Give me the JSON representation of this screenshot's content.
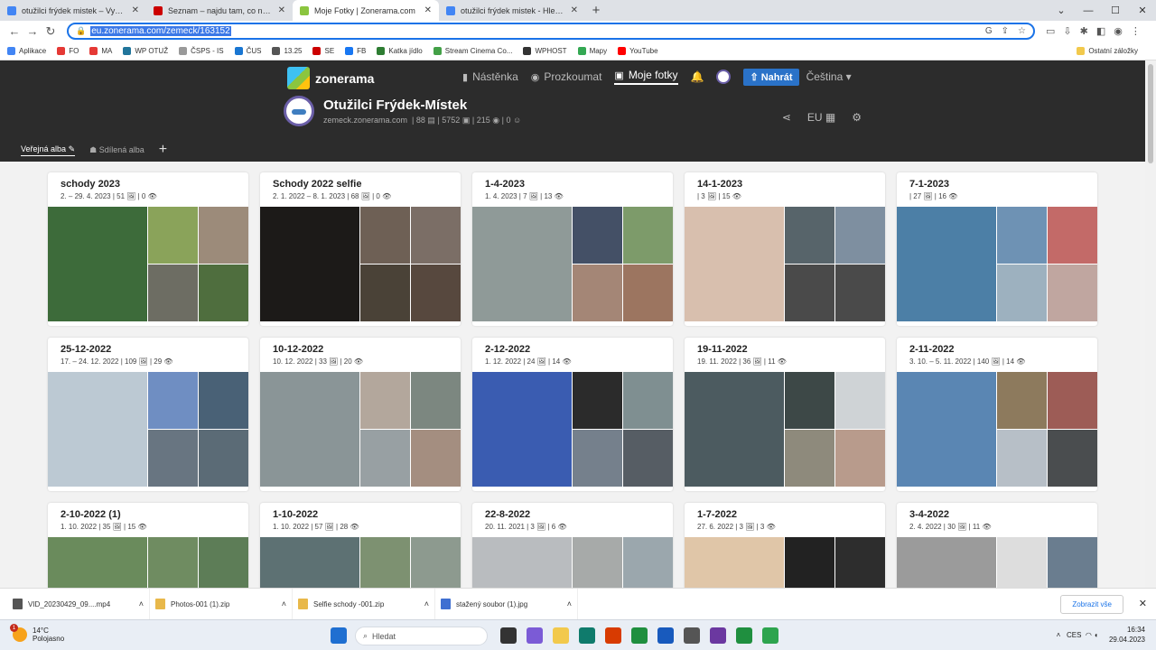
{
  "browser": {
    "tabs": [
      {
        "label": "otužilci frýdek mistek – Vyhledá",
        "favicon": "google",
        "color": "#4285f4"
      },
      {
        "label": "Seznam – najdu tam, co neznám",
        "favicon": "seznam",
        "color": "#cc0000"
      },
      {
        "label": "Moje Fotky | Zonerama.com",
        "favicon": "zonerama",
        "color": "#8bc53f",
        "active": true
      },
      {
        "label": "otužilci frýdek mistek - Hledat G",
        "favicon": "google",
        "color": "#4285f4"
      }
    ],
    "url": "eu.zonerama.com/zemeck/163152",
    "bookmarks": [
      {
        "label": "Aplikace",
        "color": "#4285f4"
      },
      {
        "label": "FO",
        "color": "#e53935"
      },
      {
        "label": "MA",
        "color": "#e53935"
      },
      {
        "label": "WP OTUŽ",
        "color": "#21759b"
      },
      {
        "label": "ČSPS - IS",
        "color": "#999999"
      },
      {
        "label": "ČUS",
        "color": "#1976d2"
      },
      {
        "label": "13.25",
        "color": "#555555"
      },
      {
        "label": "SE",
        "color": "#cc0000"
      },
      {
        "label": "FB",
        "color": "#1877f2"
      },
      {
        "label": "Katka jídlo",
        "color": "#2e7d32"
      },
      {
        "label": "Stream Cinema Co...",
        "color": "#43a047"
      },
      {
        "label": "WPHOST",
        "color": "#333333"
      },
      {
        "label": "Mapy",
        "color": "#34a853"
      },
      {
        "label": "YouTube",
        "color": "#ff0000"
      }
    ],
    "other_bookmarks": "Ostatní záložky"
  },
  "site": {
    "logo": "zonerama",
    "nav": [
      {
        "label": "Nástěnka",
        "icon": "chart-icon"
      },
      {
        "label": "Prozkoumat",
        "icon": "compass-icon"
      },
      {
        "label": "Moje fotky",
        "icon": "photos-icon",
        "active": true
      }
    ],
    "upload": "Nahrát",
    "language": "Čeština",
    "profile": {
      "title": "Otužilci Frýdek-Místek",
      "domain": "zemeck.zonerama.com",
      "albums": "88",
      "photos": "5752",
      "views": "215",
      "followers": "0"
    },
    "region": "EU",
    "subtabs": [
      {
        "label": "Veřejná alba",
        "active": true
      },
      {
        "label": "Sdílená alba"
      }
    ]
  },
  "albums": [
    {
      "title": "schody 2023",
      "meta": "2. – 29. 4. 2023 | 51 🖼 | 0 👁",
      "colors": [
        "#3d6b3a",
        "#8aa35a",
        "#9c8b7a",
        "#6d6d63",
        "#4f6e3e"
      ]
    },
    {
      "title": "Schody 2022 selfie",
      "meta": "2. 1. 2022 – 8. 1. 2023 | 68 🖼 | 0 👁",
      "colors": [
        "#1c1a18",
        "#6e6055",
        "#7b6e66",
        "#4a4237",
        "#57483e"
      ]
    },
    {
      "title": "1-4-2023",
      "meta": "1. 4. 2023 | 7 🖼 | 13 👁",
      "colors": [
        "#8f9a98",
        "#445066",
        "#7d9b6a",
        "#a48676",
        "#9c7560"
      ]
    },
    {
      "title": "14-1-2023",
      "meta": "| 3 🖼 | 15 👁",
      "colors": [
        "#d8bfae",
        "#57646a",
        "#7e8fa0",
        "#4a4a4a",
        "#4a4a4a"
      ]
    },
    {
      "title": "7-1-2023",
      "meta": "| 27 🖼 | 16 👁",
      "colors": [
        "#4c7fa6",
        "#6e92b4",
        "#c36a68",
        "#9db1bf",
        "#c0a6a0"
      ]
    },
    {
      "title": "25-12-2022",
      "meta": "17. – 24. 12. 2022 | 109 🖼 | 29 👁",
      "colors": [
        "#bcc9d3",
        "#6f8ec2",
        "#496176",
        "#687581",
        "#5b6b76"
      ]
    },
    {
      "title": "10-12-2022",
      "meta": "10. 12. 2022 | 33 🖼 | 20 👁",
      "colors": [
        "#8a9597",
        "#b3a79c",
        "#7c8780",
        "#98a0a3",
        "#a48e80"
      ]
    },
    {
      "title": "2-12-2022",
      "meta": "1. 12. 2022 | 24 🖼 | 14 👁",
      "colors": [
        "#3a5cb1",
        "#2b2b2b",
        "#7f8f91",
        "#75808c",
        "#565d64"
      ]
    },
    {
      "title": "19-11-2022",
      "meta": "19. 11. 2022 | 36 🖼 | 11 👁",
      "colors": [
        "#4c5b60",
        "#3d4847",
        "#cfd3d6",
        "#8e8a7c",
        "#b89b8c"
      ]
    },
    {
      "title": "2-11-2022",
      "meta": "3. 10. – 5. 11. 2022 | 140 🖼 | 14 👁",
      "colors": [
        "#5a86b3",
        "#8d7a5d",
        "#9d5c56",
        "#b7bfc7",
        "#4a4d4f"
      ]
    },
    {
      "title": "2-10-2022 (1)",
      "meta": "1. 10. 2022 | 35 🖼 | 15 👁",
      "colors": [
        "#6a8b5c",
        "#6f8c61",
        "#5d7d57",
        "#b39c8a",
        "#7a8f6b"
      ]
    },
    {
      "title": "1-10-2022",
      "meta": "1. 10. 2022 | 57 🖼 | 28 👁",
      "colors": [
        "#5d7173",
        "#7d9171",
        "#8d9a8f",
        "#767e79",
        "#6b7769"
      ]
    },
    {
      "title": "22-8-2022",
      "meta": "20. 11. 2021 | 3 🖼 | 6 👁",
      "colors": [
        "#b9bcbf",
        "#a7aaa9",
        "#9ba7ad",
        "#d8d8d8",
        "#d8d8d8"
      ]
    },
    {
      "title": "1-7-2022",
      "meta": "27. 6. 2022 | 3 🖼 | 3 👁",
      "colors": [
        "#e0c6a8",
        "#222222",
        "#2d2d2d",
        "#efefef",
        "#efefef"
      ]
    },
    {
      "title": "3-4-2022",
      "meta": "2. 4. 2022 | 30 🖼 | 11 👁",
      "colors": [
        "#9b9b9b",
        "#dddddd",
        "#6a7d8f",
        "#888888",
        "#777777"
      ]
    }
  ],
  "downloads": [
    {
      "name": "VID_20230429_09....mp4",
      "color": "#555555"
    },
    {
      "name": "Photos-001 (1).zip",
      "color": "#e8b84a"
    },
    {
      "name": "Selfie schody -001.zip",
      "color": "#e8b84a"
    },
    {
      "name": "stažený soubor (1).jpg",
      "color": "#3f6fd1"
    }
  ],
  "downloads_show_all": "Zobrazit vše",
  "taskbar": {
    "temp": "14°C",
    "weather": "Polojasno",
    "weather_badge": "1",
    "search": "Hledat",
    "lang": "CES",
    "time": "16:34",
    "date": "29.04.2023",
    "apps": [
      "#1f6fd1",
      "#333333",
      "#7b5bd6",
      "#f2c94c",
      "#0f7b6c",
      "#d83b01",
      "#1f8f3f",
      "#185abd",
      "#555555",
      "#6b38a0",
      "#1f8f3f",
      "#2da44e"
    ]
  }
}
